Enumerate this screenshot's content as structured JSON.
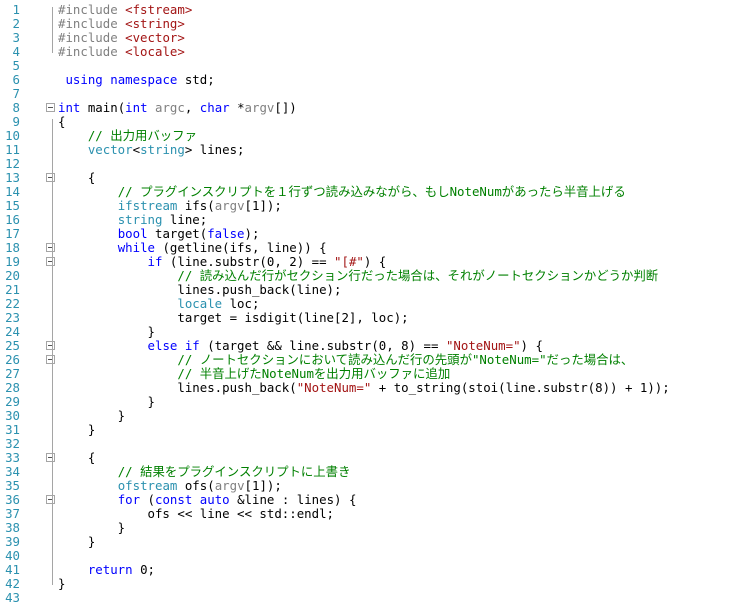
{
  "editor": {
    "lines": [
      {
        "n": "1",
        "fold": false,
        "tokens": [
          [
            "p",
            "#include "
          ],
          [
            "s",
            "<fstream>"
          ]
        ]
      },
      {
        "n": "2",
        "fold": false,
        "tokens": [
          [
            "p",
            "#include "
          ],
          [
            "s",
            "<string>"
          ]
        ]
      },
      {
        "n": "3",
        "fold": false,
        "tokens": [
          [
            "p",
            "#include "
          ],
          [
            "s",
            "<vector>"
          ]
        ]
      },
      {
        "n": "4",
        "fold": false,
        "tokens": [
          [
            "p",
            "#include "
          ],
          [
            "s",
            "<locale>"
          ]
        ]
      },
      {
        "n": "5",
        "fold": false,
        "tokens": []
      },
      {
        "n": "6",
        "fold": false,
        "tokens": [
          [
            "x",
            " "
          ],
          [
            "k",
            "using"
          ],
          [
            "x",
            " "
          ],
          [
            "k",
            "namespace"
          ],
          [
            "x",
            " std;"
          ]
        ]
      },
      {
        "n": "7",
        "fold": false,
        "tokens": []
      },
      {
        "n": "8",
        "fold": true,
        "tokens": [
          [
            "k",
            "int"
          ],
          [
            "x",
            " main("
          ],
          [
            "k",
            "int"
          ],
          [
            "x",
            " "
          ],
          [
            "p",
            "argc"
          ],
          [
            "x",
            ", "
          ],
          [
            "k",
            "char"
          ],
          [
            "x",
            " *"
          ],
          [
            "p",
            "argv"
          ],
          [
            "x",
            "[])"
          ]
        ]
      },
      {
        "n": "9",
        "fold": false,
        "tokens": [
          [
            "x",
            "{"
          ]
        ]
      },
      {
        "n": "10",
        "fold": false,
        "tokens": [
          [
            "x",
            "    "
          ],
          [
            "c",
            "// 出力用バッファ"
          ]
        ]
      },
      {
        "n": "11",
        "fold": false,
        "tokens": [
          [
            "x",
            "    "
          ],
          [
            "t",
            "vector"
          ],
          [
            "x",
            "<"
          ],
          [
            "t",
            "string"
          ],
          [
            "x",
            "> lines;"
          ]
        ]
      },
      {
        "n": "12",
        "fold": false,
        "tokens": []
      },
      {
        "n": "13",
        "fold": true,
        "tokens": [
          [
            "x",
            "    {"
          ]
        ]
      },
      {
        "n": "14",
        "fold": false,
        "tokens": [
          [
            "x",
            "        "
          ],
          [
            "c",
            "// プラグインスクリプトを１行ずつ読み込みながら、もしNoteNumがあったら半音上げる"
          ]
        ]
      },
      {
        "n": "15",
        "fold": false,
        "tokens": [
          [
            "x",
            "        "
          ],
          [
            "t",
            "ifstream"
          ],
          [
            "x",
            " ifs("
          ],
          [
            "p",
            "argv"
          ],
          [
            "x",
            "[1]);"
          ]
        ]
      },
      {
        "n": "16",
        "fold": false,
        "tokens": [
          [
            "x",
            "        "
          ],
          [
            "t",
            "string"
          ],
          [
            "x",
            " line;"
          ]
        ]
      },
      {
        "n": "17",
        "fold": false,
        "tokens": [
          [
            "x",
            "        "
          ],
          [
            "k",
            "bool"
          ],
          [
            "x",
            " target("
          ],
          [
            "k",
            "false"
          ],
          [
            "x",
            ");"
          ]
        ]
      },
      {
        "n": "18",
        "fold": true,
        "tokens": [
          [
            "x",
            "        "
          ],
          [
            "k",
            "while"
          ],
          [
            "x",
            " (getline(ifs, line)) {"
          ]
        ]
      },
      {
        "n": "19",
        "fold": true,
        "tokens": [
          [
            "x",
            "            "
          ],
          [
            "k",
            "if"
          ],
          [
            "x",
            " (line.substr(0, 2) == "
          ],
          [
            "s",
            "\"[#\""
          ],
          [
            "x",
            ") {"
          ]
        ]
      },
      {
        "n": "20",
        "fold": false,
        "tokens": [
          [
            "x",
            "                "
          ],
          [
            "c",
            "// 読み込んだ行がセクション行だった場合は、それがノートセクションかどうか判断"
          ]
        ]
      },
      {
        "n": "21",
        "fold": false,
        "tokens": [
          [
            "x",
            "                lines.push_back(line);"
          ]
        ]
      },
      {
        "n": "22",
        "fold": false,
        "tokens": [
          [
            "x",
            "                "
          ],
          [
            "t",
            "locale"
          ],
          [
            "x",
            " loc;"
          ]
        ]
      },
      {
        "n": "23",
        "fold": false,
        "tokens": [
          [
            "x",
            "                target = isdigit(line[2], loc);"
          ]
        ]
      },
      {
        "n": "24",
        "fold": false,
        "tokens": [
          [
            "x",
            "            }"
          ]
        ]
      },
      {
        "n": "25",
        "fold": true,
        "tokens": [
          [
            "x",
            "            "
          ],
          [
            "k",
            "else if"
          ],
          [
            "x",
            " (target && line.substr(0, 8) == "
          ],
          [
            "s",
            "\"NoteNum=\""
          ],
          [
            "x",
            ") {"
          ]
        ]
      },
      {
        "n": "26",
        "fold": true,
        "tokens": [
          [
            "x",
            "                "
          ],
          [
            "c",
            "// ノートセクションにおいて読み込んだ行の先頭が\"NoteNum=\"だった場合は、"
          ]
        ]
      },
      {
        "n": "27",
        "fold": false,
        "tokens": [
          [
            "x",
            "                "
          ],
          [
            "c",
            "// 半音上げたNoteNumを出力用バッファに追加"
          ]
        ]
      },
      {
        "n": "28",
        "fold": false,
        "tokens": [
          [
            "x",
            "                lines.push_back("
          ],
          [
            "s",
            "\"NoteNum=\""
          ],
          [
            "x",
            " + to_string(stoi(line.substr(8)) + 1));"
          ]
        ]
      },
      {
        "n": "29",
        "fold": false,
        "tokens": [
          [
            "x",
            "            }"
          ]
        ]
      },
      {
        "n": "30",
        "fold": false,
        "tokens": [
          [
            "x",
            "        }"
          ]
        ]
      },
      {
        "n": "31",
        "fold": false,
        "tokens": [
          [
            "x",
            "    }"
          ]
        ]
      },
      {
        "n": "32",
        "fold": false,
        "tokens": []
      },
      {
        "n": "33",
        "fold": true,
        "tokens": [
          [
            "x",
            "    {"
          ]
        ]
      },
      {
        "n": "34",
        "fold": false,
        "tokens": [
          [
            "x",
            "        "
          ],
          [
            "c",
            "// 結果をプラグインスクリプトに上書き"
          ]
        ]
      },
      {
        "n": "35",
        "fold": false,
        "tokens": [
          [
            "x",
            "        "
          ],
          [
            "t",
            "ofstream"
          ],
          [
            "x",
            " ofs("
          ],
          [
            "p",
            "argv"
          ],
          [
            "x",
            "[1]);"
          ]
        ]
      },
      {
        "n": "36",
        "fold": true,
        "tokens": [
          [
            "x",
            "        "
          ],
          [
            "k",
            "for"
          ],
          [
            "x",
            " ("
          ],
          [
            "k",
            "const"
          ],
          [
            "x",
            " "
          ],
          [
            "k",
            "auto"
          ],
          [
            "x",
            " &line : lines) {"
          ]
        ]
      },
      {
        "n": "37",
        "fold": false,
        "tokens": [
          [
            "x",
            "            ofs << line << std::endl;"
          ]
        ]
      },
      {
        "n": "38",
        "fold": false,
        "tokens": [
          [
            "x",
            "        }"
          ]
        ]
      },
      {
        "n": "39",
        "fold": false,
        "tokens": [
          [
            "x",
            "    }"
          ]
        ]
      },
      {
        "n": "40",
        "fold": false,
        "tokens": []
      },
      {
        "n": "41",
        "fold": false,
        "tokens": [
          [
            "x",
            "    "
          ],
          [
            "k",
            "return"
          ],
          [
            "x",
            " 0;"
          ]
        ]
      },
      {
        "n": "42",
        "fold": false,
        "tokens": [
          [
            "x",
            "}"
          ]
        ]
      },
      {
        "n": "43",
        "fold": false,
        "tokens": []
      }
    ],
    "colors": {
      "keyword": "#0000ff",
      "type": "#2b91af",
      "string": "#a31515",
      "comment": "#008000",
      "preprocessor": "#808080",
      "line_number": "#2b91af"
    }
  }
}
